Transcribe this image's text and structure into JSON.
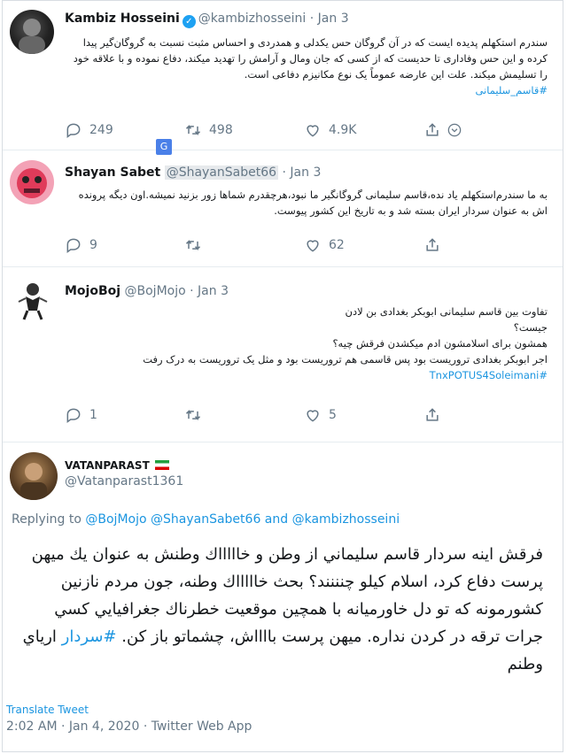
{
  "tweets": [
    {
      "name": "Kambiz Hosseini",
      "handle": "@kambizhosseini",
      "date": "Jan 3",
      "text": "سندرم استکهلم پدیده ایست که در آن گروگان حس یکدلی و همدردی و احساس مثبت نسبت به گروگان‌گیر پیدا کرده و این حس وفاداری تا حدیست که از کسی که جان ومال و آرامش را تهدید میکند، دفاع نموده و با علاقه خود را تسلیمش میکند. علت این عارضه عموماً یک نوع مکانیزم دفاعی است.",
      "hashtag": "#قاسم_سلیمانی",
      "replies": "249",
      "retweets": "498",
      "likes": "4.9K"
    },
    {
      "name": "Shayan Sabet",
      "handle": "@ShayanSabet66",
      "date": "Jan 3",
      "text": "به ما سندرم‌استکهلم یاد نده،قاسم سلیمانی گروگانگیر ما نبود،هرچقدرم شماها زور بزنید نمیشه.اون دیگه پرونده اش به عنوان سردار ایران بسته شد و به تاریخ این کشور پیوست.",
      "replies": "9",
      "retweets": "",
      "likes": "62"
    },
    {
      "name": "MojoBoj",
      "handle": "@BojMojo",
      "date": "Jan 3",
      "lines": [
        "تفاوت بین قاسم سلیمانی ابوبکر بغدادی بن لادن",
        "جیست؟",
        "همشون برای اسلامشون ادم میکشدن فرقش چیه؟",
        "اجر ابوبکر بغدادی تروریست بود پس قاسمی هم تروریست بود و مثل یک تروریست به درک رفت"
      ],
      "hashtag": "#TnxPOTUS4Soleimani",
      "replies": "1",
      "retweets": "",
      "likes": "5"
    }
  ],
  "main": {
    "name": "VATANPARAST",
    "handle": "@Vatanparast1361",
    "replying_label": "Replying to",
    "replying_handles": "@BojMojo @ShayanSabet66 and @kambizhosseini",
    "text_before": "فرقش اينه سردار قاسم سليماني از وطن و خاااااك وطنش به عنوان يك ميهن پرست دفاع كرد، اسلام كيلو چنننند؟ بحث خاااااك وطنه، جون مردم نازنين كشورمونه كه تو دل خاورميانه با همچين موقعيت خطرناك جغرافيايي كسي جرات ترقه در كردن نداره. ميهن پرست بااااش، چشماتو باز كن.",
    "hashtag": "#سردار",
    "text_after": "ارياي وطنم",
    "translate": "Translate Tweet",
    "time": "2:02 AM · Jan 4, 2020 · Twitter Web App"
  },
  "colors": {
    "link": "#1b95e0",
    "muted": "#657786",
    "verified": "#1da1f2"
  }
}
